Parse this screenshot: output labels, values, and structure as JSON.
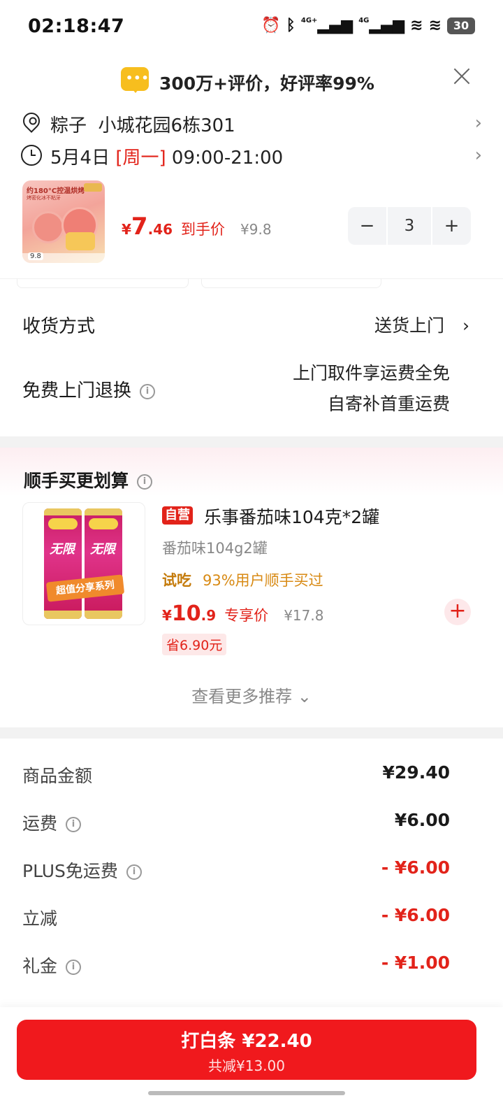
{
  "status_bar": {
    "time": "02:18:47",
    "network_1": "4G+",
    "network_2": "4G",
    "battery": "30"
  },
  "promo": {
    "text": "300万+评价，好评率99%"
  },
  "address": {
    "name": "粽子",
    "detail": "小城花园6栋301",
    "line": "粽子  小城花园6栋301"
  },
  "delivery_time": {
    "date": "5月4日",
    "weekday": "[周一]",
    "range": "09:00-21:00"
  },
  "product": {
    "thumb_title": "约180°C控温烘烤",
    "thumb_sub": "烤密化冰不粘牙",
    "thumb_price": "9.8",
    "price_yen": "¥",
    "price_int": "7",
    "price_dec": ".46",
    "price_label": "到手价",
    "orig_price": "¥9.8",
    "quantity": "3",
    "minus": "−",
    "plus": "+"
  },
  "shipping": {
    "label": "收货方式",
    "value": "送货上门",
    "chevron": "›"
  },
  "return_service": {
    "label": "免费上门退换",
    "value_line1": "上门取件享运费全免",
    "value_line2": "自寄补首重运费"
  },
  "upsell": {
    "title": "顺手买更划算",
    "self_tag": "自营",
    "name": "乐事番茄味104克*2罐",
    "spec": "番茄味104g2罐",
    "try_tag": "试吃",
    "try_text": "93%用户顺手买过",
    "price_yen": "¥",
    "price_int": "10",
    "price_dec": ".9",
    "price_label": "专享价",
    "orig_price": "¥17.8",
    "save": "省6.90元",
    "add": "+",
    "chips_brand": "无限",
    "chips_band": "超值分享系列",
    "see_more": "查看更多推荐 ⌄"
  },
  "costs": [
    {
      "label": "商品金额",
      "value": "¥29.40",
      "info": false,
      "neg": false
    },
    {
      "label": "运费",
      "value": "¥6.00",
      "info": true,
      "neg": false
    },
    {
      "label": "PLUS免运费",
      "value": "- ¥6.00",
      "info": true,
      "neg": true
    },
    {
      "label": "立减",
      "value": "- ¥6.00",
      "info": false,
      "neg": true
    },
    {
      "label": "礼金",
      "value": "- ¥1.00",
      "info": true,
      "neg": true
    }
  ],
  "pay": {
    "main": "打白条 ¥22.40",
    "sub": "共减¥13.00"
  },
  "colors": {
    "accent": "#e2231a",
    "pay_button": "#f0191d",
    "promo_bubble": "#f7be1e"
  }
}
